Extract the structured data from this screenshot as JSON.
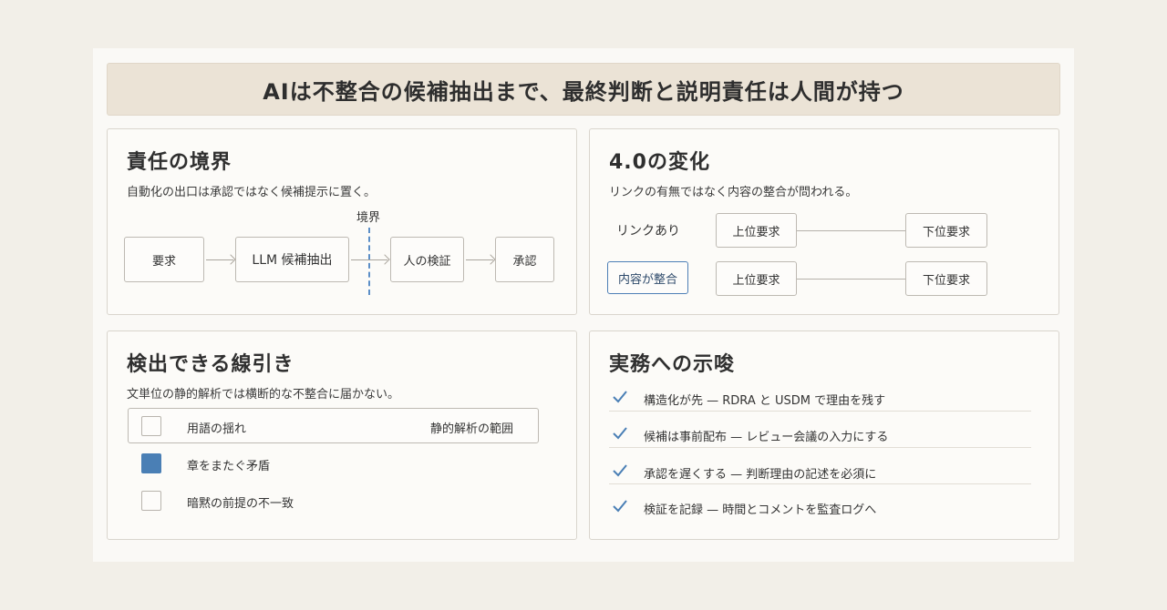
{
  "banner": {
    "title": "AIは不整合の候補抽出まで、最終判断と説明責任は人間が持つ"
  },
  "responsibility": {
    "title": "責任の境界",
    "subtitle": "自動化の出口は承認ではなく候補提示に置く。",
    "boundary_label": "境界",
    "steps": [
      "要求",
      "LLM 候補抽出",
      "人の検証",
      "承認"
    ]
  },
  "change": {
    "title": "4.0の変化",
    "subtitle": "リンクの有無ではなく内容の整合が問われる。",
    "rows": [
      {
        "label": "リンクあり",
        "upper": "上位要求",
        "lower": "下位要求"
      },
      {
        "label": "内容が整合",
        "upper": "上位要求",
        "lower": "下位要求"
      }
    ]
  },
  "detect": {
    "title": "検出できる線引き",
    "subtitle": "文単位の静的解析では横断的な不整合に届かない。",
    "range_label": "静的解析の範囲",
    "items": [
      {
        "label": "用語の揺れ",
        "checked": false
      },
      {
        "label": "章をまたぐ矛盾",
        "checked": true
      },
      {
        "label": "暗黙の前提の不一致",
        "checked": false
      }
    ]
  },
  "practice": {
    "title": "実務への示唆",
    "items": [
      "構造化が先 — RDRA と USDM で理由を残す",
      "候補は事前配布 — レビュー会議の入力にする",
      "承認を遅くする — 判断理由の記述を必須に",
      "検証を記録 — 時間とコメントを監査ログへ"
    ],
    "accent_color": "#4a7fb5"
  }
}
